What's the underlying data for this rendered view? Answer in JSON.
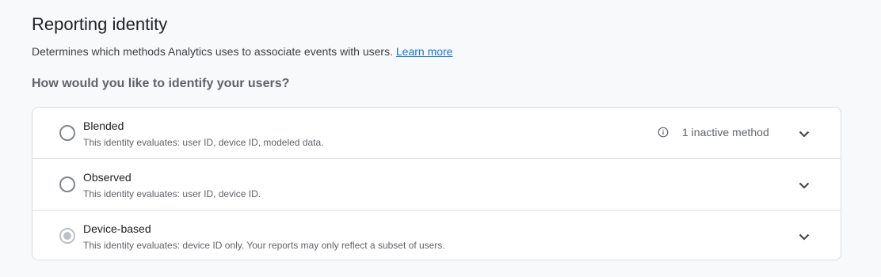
{
  "header": {
    "title": "Reporting identity",
    "description": "Determines which methods Analytics uses to associate events with users.",
    "learn_more": "Learn more",
    "question": "How would you like to identify your users?"
  },
  "options": [
    {
      "label": "Blended",
      "sub": "This identity evaluates: user ID, device ID, modeled data.",
      "selected": false,
      "status": "1 inactive method"
    },
    {
      "label": "Observed",
      "sub": "This identity evaluates: user ID, device ID.",
      "selected": false
    },
    {
      "label": "Device-based",
      "sub": "This identity evaluates: device ID only. Your reports may only reflect a subset of users.",
      "selected": true
    }
  ],
  "icons": {
    "info": "info-circle-icon",
    "expand": "chevron-down-icon"
  },
  "colors": {
    "link": "#1a73e8",
    "border": "#dadce0",
    "selected_radio": "#bdc1c6"
  }
}
